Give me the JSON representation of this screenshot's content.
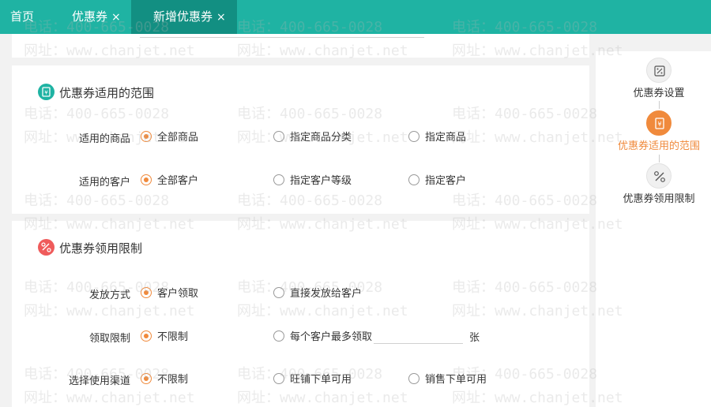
{
  "tabs": [
    {
      "label": "首页",
      "closable": false,
      "active": false
    },
    {
      "label": "优惠券",
      "closable": true,
      "active": false
    },
    {
      "label": "新增优惠券",
      "closable": true,
      "active": true
    }
  ],
  "close_glyph": "×",
  "scope": {
    "title": "优惠券适用的范围",
    "icon": "coupon-icon",
    "products": {
      "label": "适用的商品",
      "options": [
        "全部商品",
        "指定商品分类",
        "指定商品"
      ],
      "selected": "全部商品"
    },
    "customers": {
      "label": "适用的客户",
      "options": [
        "全部客户",
        "指定客户等级",
        "指定客户"
      ],
      "selected": "全部客户"
    }
  },
  "limit": {
    "title": "优惠券领用限制",
    "icon": "ticket-cut-icon",
    "issue_method": {
      "label": "发放方式",
      "options": [
        "客户领取",
        "直接发放给客户"
      ],
      "selected": "客户领取"
    },
    "claim_limit": {
      "label": "领取限制",
      "options": [
        "不限制",
        "每个客户最多领取"
      ],
      "selected": "不限制",
      "unit": "张"
    },
    "channel": {
      "label": "选择使用渠道",
      "options": [
        "不限制",
        "旺铺下单可用",
        "销售下单可用"
      ],
      "selected": "不限制"
    }
  },
  "steps": [
    {
      "label": "优惠券设置",
      "icon": "percent-tag-icon",
      "active": false
    },
    {
      "label": "优惠券适用的范围",
      "icon": "coupon-icon",
      "active": true
    },
    {
      "label": "优惠券领用限制",
      "icon": "ticket-cut-icon",
      "active": false
    }
  ],
  "watermark": {
    "phone": "电话：400-665-0028",
    "site": "网址：www.chanjet.net"
  },
  "colors": {
    "tab_bar": "#1fb3a3",
    "tab_active": "#128f82",
    "accent_orange": "#f08a3c",
    "scope_icon": "#1fb3a3",
    "limit_icon": "#ef5b5b"
  }
}
